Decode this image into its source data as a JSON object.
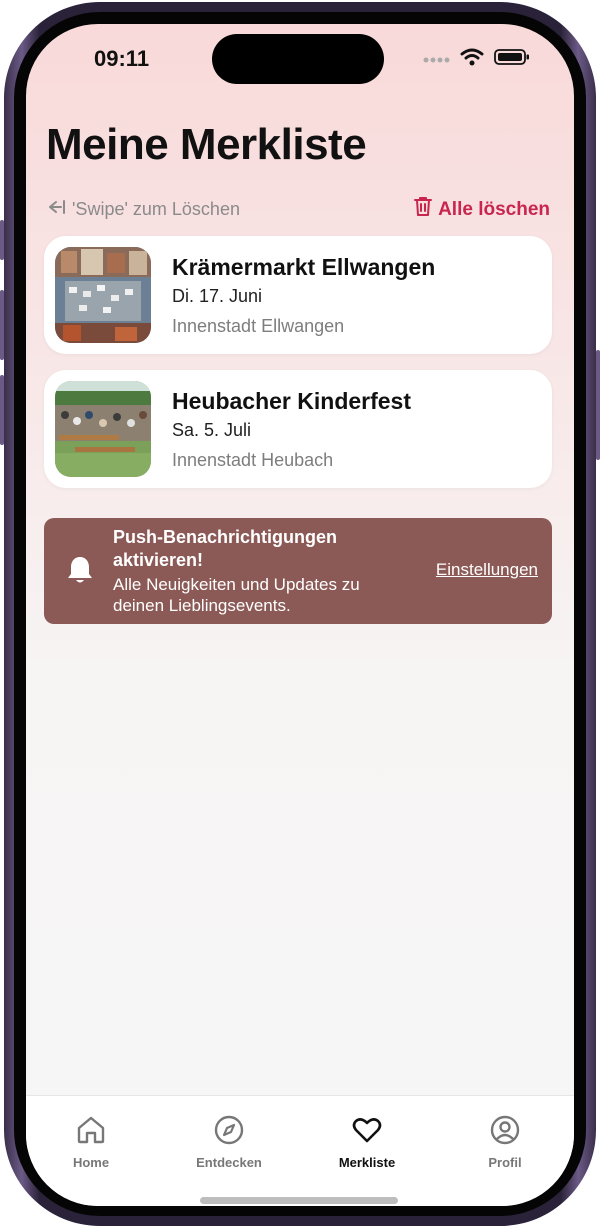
{
  "status_bar": {
    "time": "09:11"
  },
  "page": {
    "title": "Meine Merkliste",
    "swipe_hint": "'Swipe' zum Löschen",
    "clear_all_label": "Alle löschen"
  },
  "favorites": [
    {
      "title": "Krämermarkt Ellwangen",
      "date": "Di. 17. Juni",
      "location": "Innenstadt Ellwangen"
    },
    {
      "title": "Heubacher Kinderfest",
      "date": "Sa. 5. Juli",
      "location": "Innenstadt Heubach"
    }
  ],
  "push_banner": {
    "title": "Push-Benachrichtigungen aktivieren!",
    "text": "Alle Neuigkeiten und Updates zu deinen Lieblingsevents.",
    "link_label": "Einstellungen"
  },
  "tabbar": {
    "items": [
      {
        "label": "Home",
        "icon": "home-icon"
      },
      {
        "label": "Entdecken",
        "icon": "compass-icon"
      },
      {
        "label": "Merkliste",
        "icon": "heart-icon",
        "active": true
      },
      {
        "label": "Profil",
        "icon": "profile-icon"
      }
    ]
  },
  "colors": {
    "accent": "#c8264f",
    "banner": "#8b5a56"
  }
}
